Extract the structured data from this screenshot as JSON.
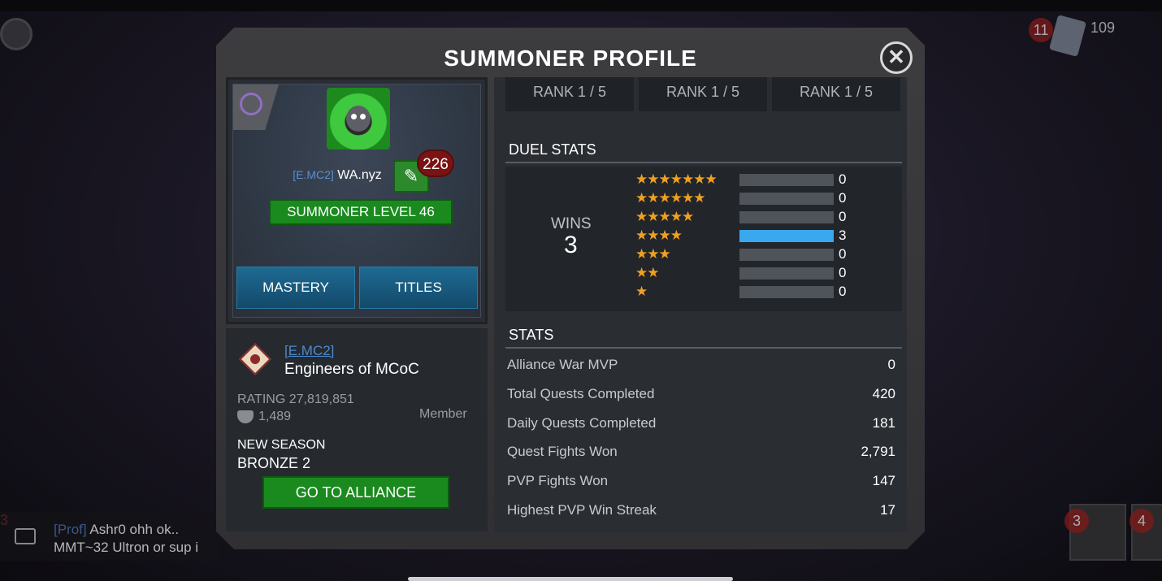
{
  "background": {
    "top_counter_left": "11",
    "top_counter_right": "109",
    "chat": {
      "line1_tag": "[Prof]",
      "line1_text": "Ashr0 ohh ok..",
      "line2_text": "MMT~32 Ultron or sup i"
    },
    "left_edge_number": "3",
    "right_badges": [
      "3",
      "4"
    ]
  },
  "modal": {
    "title": "SUMMONER PROFILE",
    "close_icon": "close-icon"
  },
  "profile": {
    "alliance_tag": "[E.MC2]",
    "name": "WA.nyz",
    "edit_badge_count": "226",
    "level_label": "SUMMONER LEVEL 46",
    "tabs": {
      "mastery": "MASTERY",
      "titles": "TITLES"
    }
  },
  "alliance": {
    "tag": "[E.MC2]",
    "name": "Engineers of MCoC",
    "rating": "RATING 27,819,851",
    "member_count": "1,489",
    "role": "Member",
    "season_label": "NEW SEASON",
    "season_value": "BRONZE 2",
    "go_button": "GO TO ALLIANCE"
  },
  "ranks": [
    "RANK 1 / 5",
    "RANK 1 / 5",
    "RANK 1 / 5"
  ],
  "duel_stats": {
    "title": "DUEL STATS",
    "wins_label": "WINS",
    "wins_value": "3",
    "rows": [
      {
        "stars": "★★★★★★★",
        "count": "0",
        "fill": 0
      },
      {
        "stars": "★★★★★★",
        "count": "0",
        "fill": 0
      },
      {
        "stars": "★★★★★",
        "count": "0",
        "fill": 0
      },
      {
        "stars": "★★★★",
        "count": "3",
        "fill": 1
      },
      {
        "stars": "★★★",
        "count": "0",
        "fill": 0
      },
      {
        "stars": "★★",
        "count": "0",
        "fill": 0
      },
      {
        "stars": "★",
        "count": "0",
        "fill": 0
      }
    ]
  },
  "stats": {
    "title": "STATS",
    "rows": [
      {
        "label": "Alliance War MVP",
        "value": "0"
      },
      {
        "label": "Total Quests Completed",
        "value": "420"
      },
      {
        "label": "Daily Quests Completed",
        "value": "181"
      },
      {
        "label": "Quest Fights Won",
        "value": "2,791"
      },
      {
        "label": "PVP Fights Won",
        "value": "147"
      },
      {
        "label": "Highest PVP Win Streak",
        "value": "17"
      }
    ]
  },
  "colors": {
    "accent_green": "#1a8a1e",
    "tab_blue": "#1e6a92",
    "bar_fill": "#3aa8ec",
    "star": "#f0a020",
    "link_blue": "#4a8ad0"
  }
}
